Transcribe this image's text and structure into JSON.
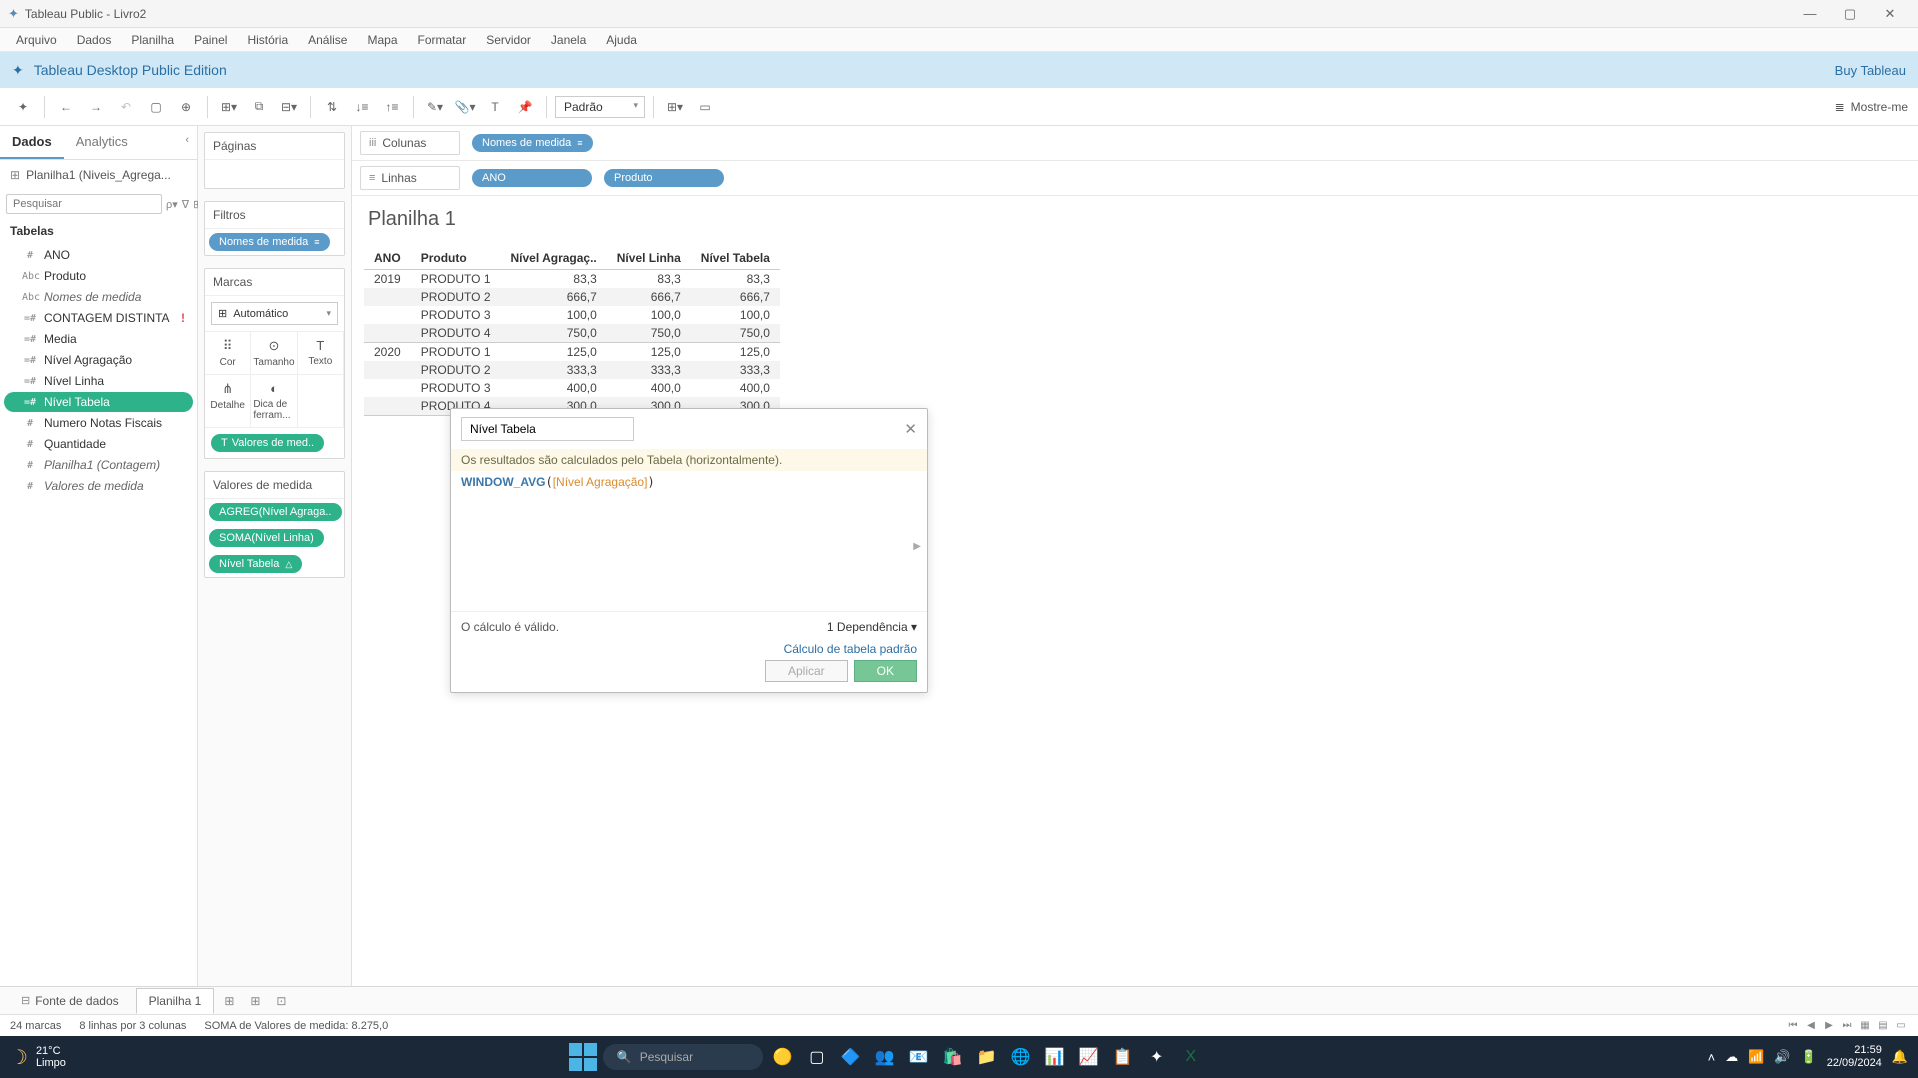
{
  "window": {
    "title": "Tableau Public - Livro2"
  },
  "menu": [
    "Arquivo",
    "Dados",
    "Planilha",
    "Painel",
    "História",
    "Análise",
    "Mapa",
    "Formatar",
    "Servidor",
    "Janela",
    "Ajuda"
  ],
  "banner": {
    "text": "Tableau Desktop Public Edition",
    "buy": "Buy Tableau"
  },
  "toolbar": {
    "fit": "Padrão",
    "showme": "Mostre-me"
  },
  "side": {
    "tabs": [
      "Dados",
      "Analytics"
    ],
    "source": "Planilha1 (Niveis_Agrega...",
    "search_ph": "Pesquisar",
    "tables": "Tabelas",
    "fields": [
      {
        "icon": "#",
        "label": "ANO",
        "italic": false,
        "sel": false
      },
      {
        "icon": "Abc",
        "label": "Produto",
        "italic": false,
        "sel": false
      },
      {
        "icon": "Abc",
        "label": "Nomes de medida",
        "italic": true,
        "sel": false
      },
      {
        "icon": "=#",
        "label": "CONTAGEM DISTINTA",
        "italic": false,
        "sel": false,
        "warn": true
      },
      {
        "icon": "=#",
        "label": "Media",
        "italic": false,
        "sel": false
      },
      {
        "icon": "=#",
        "label": "Nível Agragação",
        "italic": false,
        "sel": false
      },
      {
        "icon": "=#",
        "label": "Nível Linha",
        "italic": false,
        "sel": false
      },
      {
        "icon": "=#",
        "label": "Nível Tabela",
        "italic": false,
        "sel": true
      },
      {
        "icon": "#",
        "label": "Numero Notas Fiscais",
        "italic": false,
        "sel": false
      },
      {
        "icon": "#",
        "label": "Quantidade",
        "italic": false,
        "sel": false
      },
      {
        "icon": "#",
        "label": "Planilha1 (Contagem)",
        "italic": true,
        "sel": false
      },
      {
        "icon": "#",
        "label": "Valores de medida",
        "italic": true,
        "sel": false
      }
    ]
  },
  "cards": {
    "pages": "Páginas",
    "filters": "Filtros",
    "filterPills": [
      {
        "label": "Nomes de medida",
        "dd": true
      }
    ],
    "marks": "Marcas",
    "markType": "Automático",
    "markCells": [
      {
        "icon": "⠿",
        "label": "Cor"
      },
      {
        "icon": "⊙",
        "label": "Tamanho"
      },
      {
        "icon": "T",
        "label": "Texto"
      },
      {
        "icon": "⋔",
        "label": "Detalhe"
      },
      {
        "icon": "◐",
        "label": "Dica de ferram..."
      }
    ],
    "marksPill": "Valores de med..",
    "mv": "Valores de medida",
    "mvPills": [
      {
        "label": "AGREG(Nível Agraga..",
        "warn": false
      },
      {
        "label": "SOMA(Nível Linha)",
        "warn": false
      },
      {
        "label": "Nível Tabela",
        "warn": true
      }
    ]
  },
  "shelves": {
    "cols_label": "Colunas",
    "rows_label": "Linhas",
    "colPills": [
      {
        "label": "Nomes de medida",
        "dd": true
      }
    ],
    "rowPills": [
      {
        "label": "ANO",
        "dd": false
      },
      {
        "label": "Produto",
        "dd": false
      }
    ]
  },
  "sheet_title": "Planilha 1",
  "grid": {
    "headers": [
      "ANO",
      "Produto",
      "Nível Agragaç..",
      "Nível Linha",
      "Nível Tabela"
    ],
    "rows": [
      {
        "ano": "2019",
        "produto": "PRODUTO 1",
        "v": [
          "83,3",
          "83,3",
          "83,3"
        ],
        "alt": false
      },
      {
        "ano": "",
        "produto": "PRODUTO 2",
        "v": [
          "666,7",
          "666,7",
          "666,7"
        ],
        "alt": true
      },
      {
        "ano": "",
        "produto": "PRODUTO 3",
        "v": [
          "100,0",
          "100,0",
          "100,0"
        ],
        "alt": false
      },
      {
        "ano": "",
        "produto": "PRODUTO 4",
        "v": [
          "750,0",
          "750,0",
          "750,0"
        ],
        "alt": true,
        "lastg": true
      },
      {
        "ano": "2020",
        "produto": "PRODUTO 1",
        "v": [
          "125,0",
          "125,0",
          "125,0"
        ],
        "alt": false
      },
      {
        "ano": "",
        "produto": "PRODUTO 2",
        "v": [
          "333,3",
          "333,3",
          "333,3"
        ],
        "alt": true
      },
      {
        "ano": "",
        "produto": "PRODUTO 3",
        "v": [
          "400,0",
          "400,0",
          "400,0"
        ],
        "alt": false
      },
      {
        "ano": "",
        "produto": "PRODUTO 4",
        "v": [
          "300,0",
          "300,0",
          "300,0"
        ],
        "alt": true,
        "lastg": true
      }
    ]
  },
  "calc": {
    "name": "Nível Tabela",
    "msg": "Os resultados são calculados pelo Tabela (horizontalmente).",
    "fn": "WINDOW_AVG",
    "fld": "Nível Agragação",
    "valid": "O cálculo é válido.",
    "dep": "1 Dependência ▾",
    "link": "Cálculo de tabela padrão",
    "apply": "Aplicar",
    "ok": "OK"
  },
  "tabs": {
    "ds": "Fonte de dados",
    "sheet": "Planilha 1"
  },
  "status": {
    "marks": "24 marcas",
    "rc": "8 linhas por 3 colunas",
    "sum": "SOMA de Valores de medida: 8.275,0"
  },
  "taskbar": {
    "temp": "21°C",
    "cond": "Limpo",
    "search": "Pesquisar",
    "time": "21:59",
    "date": "22/09/2024"
  }
}
